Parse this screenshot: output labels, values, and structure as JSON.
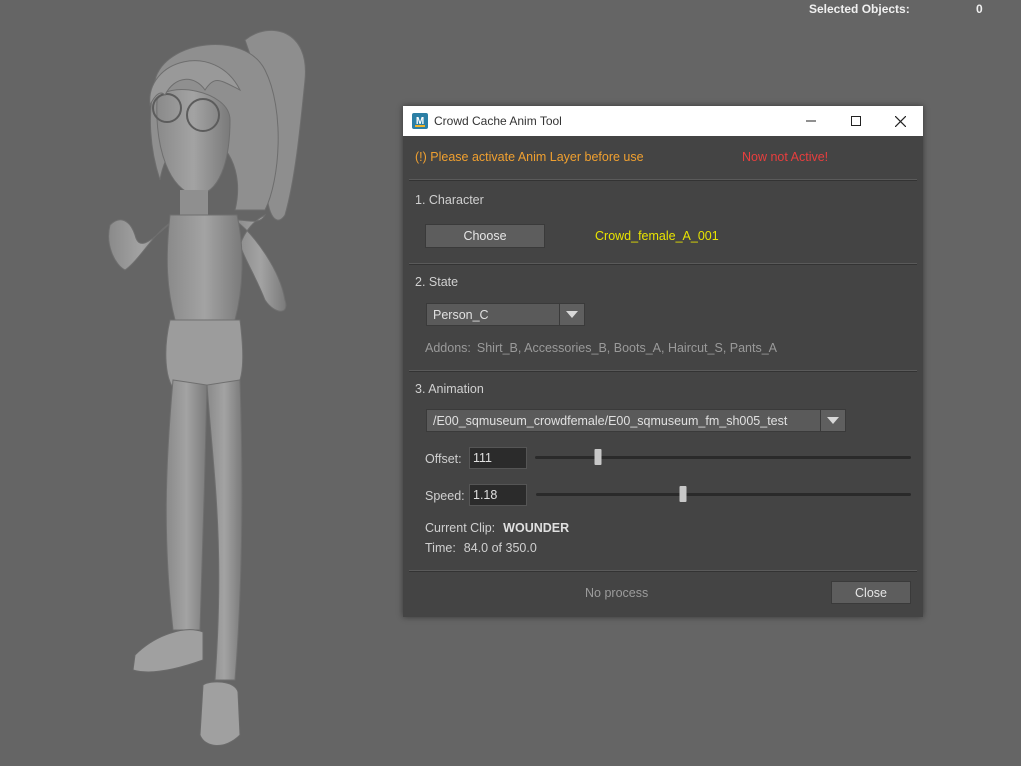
{
  "viewport": {
    "hud_label": "Selected Objects:",
    "hud_value": "0"
  },
  "window": {
    "title": "Crowd Cache Anim Tool",
    "warning": "(!) Please activate Anim Layer before use",
    "status_inactive": "Now not Active!",
    "character": {
      "section_title": "1. Character",
      "choose_label": "Choose",
      "name": "Crowd_female_A_001"
    },
    "state": {
      "section_title": "2. State",
      "selected": "Person_C",
      "addons_label": "Addons:",
      "addons_value": "Shirt_B, Accessories_B, Boots_A, Haircut_S, Pants_A"
    },
    "animation": {
      "section_title": "3. Animation",
      "selected_path": "/E00_sqmuseum_crowdfemale/E00_sqmuseum_fm_sh005_test",
      "offset_label": "Offset:",
      "offset_value": "111",
      "offset_slider_fraction": 0.168,
      "speed_label": "Speed:",
      "speed_value": "1.18",
      "speed_slider_fraction": 0.393,
      "clip_label": "Current Clip:",
      "clip_value": "WOUNDER",
      "time_label": "Time:",
      "time_value": "84.0 of 350.0"
    },
    "footer": {
      "status": "No process",
      "close_label": "Close"
    }
  },
  "colors": {
    "viewport_bg": "#656565",
    "panel_bg": "#444444",
    "warning": "#f0a030",
    "inactive": "#e83e3e",
    "character_name": "#e8e400"
  }
}
